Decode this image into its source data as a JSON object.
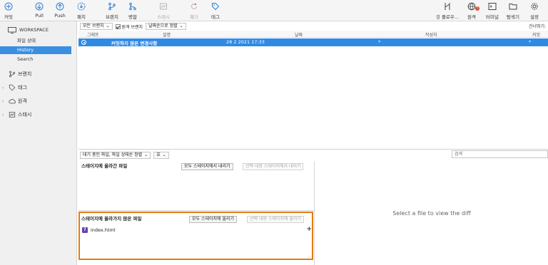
{
  "toolbar": {
    "commit": "커밋",
    "pull": "Pull",
    "push": "Push",
    "fetch": "패치",
    "branch": "브랜치",
    "merge": "병합",
    "stash": "스태시",
    "discard": "폐기",
    "tag": "태그",
    "gitflow": "깃 플로우...",
    "remote": "원격",
    "terminal": "터미널",
    "explorer": "탐색기",
    "settings": "설정",
    "remote_badge": "!"
  },
  "sidebar": {
    "workspace": "WORKSPACE",
    "items": [
      {
        "label": "파일 상태"
      },
      {
        "label": "History"
      },
      {
        "label": "Search"
      }
    ],
    "groups": [
      {
        "label": "브랜치"
      },
      {
        "label": "태그"
      },
      {
        "label": "원격"
      },
      {
        "label": "스태시"
      }
    ]
  },
  "filter": {
    "branches": "모든 브랜치",
    "remote_branches": "원격 브랜치",
    "sort": "날짜순으로 정렬",
    "skip": "건너뛰기:"
  },
  "table": {
    "columns": [
      "그래프",
      "설명",
      "날짜",
      "작성자",
      "커밋"
    ],
    "rows": [
      {
        "description": "커밋하지 않은 변경사항",
        "date": "28 2 2021 17:33",
        "author": "*",
        "commit": "*"
      }
    ]
  },
  "files": {
    "mode": "대기 중인 파일, 파일 상태순 정렬",
    "search_placeholder": "검색",
    "staged_title": "스테이지에 올라간 파일",
    "unstage_all": "모두 스테이지에서 내리기",
    "unstage_selected": "선택 내용 스테이지에서 내리기",
    "unstaged_title": "스테이지에 올라가지 않은 파일",
    "stage_all": "모두 스테이지에 올리기",
    "stage_selected": "선택 내용 스테이지에 올리기",
    "unstaged_files": [
      {
        "name": "index.html",
        "status": "?"
      }
    ]
  },
  "diff": {
    "empty_message": "Select a file to view the diff"
  },
  "colors": {
    "accent": "#2f8ae6",
    "highlight": "#e07d10",
    "untracked": "#6a3fb2"
  }
}
